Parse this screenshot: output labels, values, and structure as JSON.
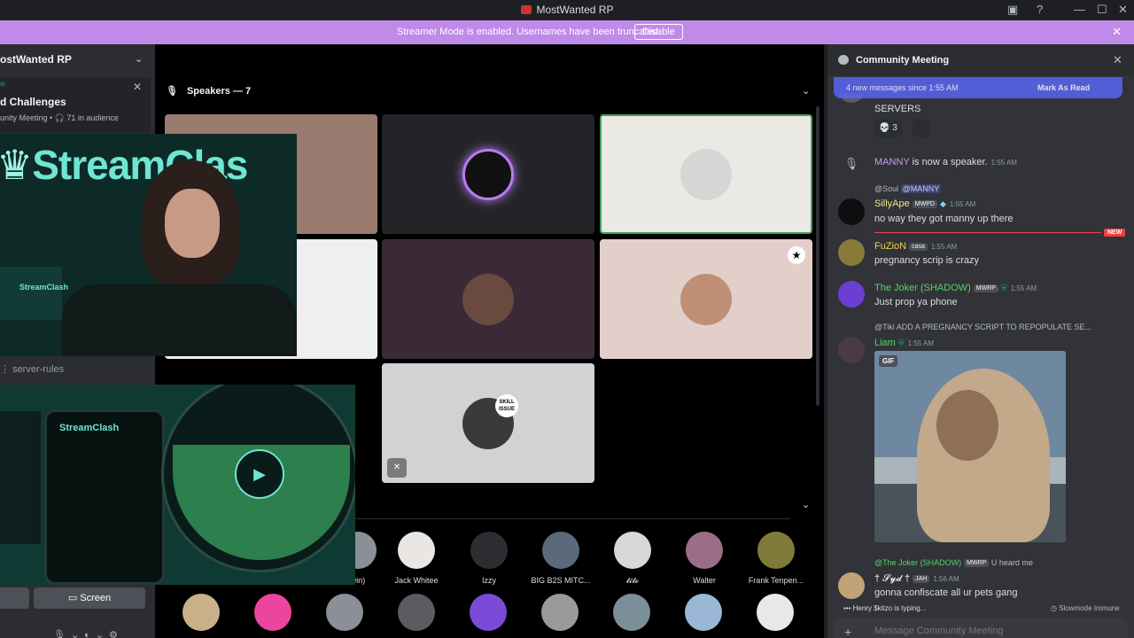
{
  "window": {
    "title": "MostWanted RP"
  },
  "banner": {
    "message": "Streamer Mode is enabled. Usernames have been truncated.",
    "disable_label": "Disable"
  },
  "sidebar": {
    "server_name": "ostWanted RP",
    "event_live": "w",
    "event_name": "d Challenges",
    "event_meta": "unity Meeting • 🎧 71 in audience",
    "channel": "server-rules",
    "screen_label": "Screen"
  },
  "stage": {
    "speakers_header": "Speakers — 7",
    "skill_badge": "SKILL ISSUE",
    "audience_row1": [
      {
        "name": "win)",
        "color": "#8a8f98"
      },
      {
        "name": "Jack Whitee",
        "color": "#e9e6e4"
      },
      {
        "name": "Izzy",
        "color": "#2b2d31"
      },
      {
        "name": "BIG B2S MITC...",
        "color": "#5a6a7a"
      },
      {
        "name": "𝓽𝓲𝓽𝓸",
        "color": "#d8d8d8"
      },
      {
        "name": "Walter",
        "color": "#9a6f86"
      },
      {
        "name": "Frank Tenpen...",
        "color": "#7f7a3a"
      }
    ],
    "audience_row2_colors": [
      "#c9b089",
      "#eb459e",
      "#8a8f98",
      "#5a5c60",
      "#7a4bd6",
      "#9a9a9a",
      "#7a8f9a",
      "#9ab8d6",
      "#e8e8e8"
    ],
    "cam_brand": "StreamClas",
    "cam_label": "StreamClash",
    "cam2_label": "StreamClash"
  },
  "chat": {
    "title": "Community Meeting",
    "new_messages": "4 new messages since 1:55 AM",
    "mark_read": "Mark As Read",
    "messages": {
      "m0_text": "SERVERS",
      "m0_reaction": "💀 3",
      "sys_name": "MANNY",
      "sys_text": "is now a speaker.",
      "sys_time": "1:55 AM",
      "m1_reply_user": "@Soul",
      "m1_reply_mention": "@MANNY",
      "m1_name": "SillyApe",
      "m1_tag": "MWPD",
      "m1_time": "1:55 AM",
      "m1_text": "no way they got manny up there",
      "m2_name": "FuZioN",
      "m2_tag": "casa",
      "m2_time": "1:55 AM",
      "m2_text": "pregnancy scrip is crazy",
      "m3_name": "The Joker (SHADOW)",
      "m3_tag": "MWRP",
      "m3_time": "1:55 AM",
      "m3_text": "Just prop ya phone",
      "m4_reply": "@Tiki ADD A PREGNANCY SCRIPT TO REPOPULATE SE...",
      "m4_name": "Liam",
      "m4_time": "1:55 AM",
      "m4_gif": "GIF",
      "m5_reply_user": "@The Joker (SHADOW)",
      "m5_reply_tag": "MWRP",
      "m5_reply_text": "U heard me",
      "m5_name": "† 𝓢𝔂𝓭 †",
      "m5_tag": "JAH",
      "m5_time": "1:56 AM",
      "m5_text": "gonna confiscate all ur pets gang",
      "new_pill": "NEW"
    },
    "typing": "Henry $kitzo is typing...",
    "slowmode": "Slowmode Immune",
    "compose_placeholder": "Message Community Meeting"
  },
  "colors": {
    "banner": "#c08ae8",
    "accent": "#5865f2",
    "live": "#23a55a",
    "new": "#f23f43"
  }
}
